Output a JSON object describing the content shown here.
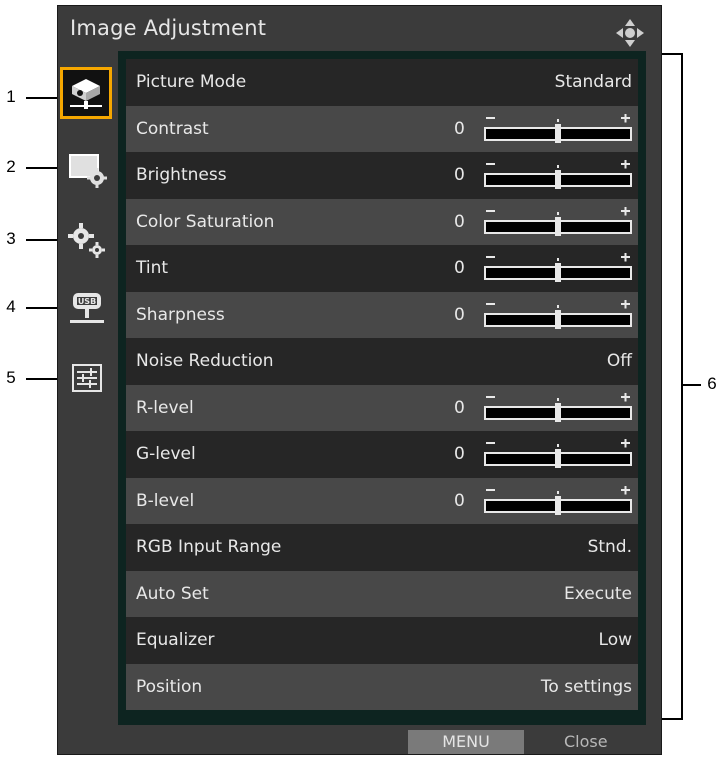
{
  "callouts": {
    "left": [
      "1",
      "2",
      "3",
      "4",
      "5"
    ],
    "right": "6"
  },
  "window": {
    "title": "Image Adjustment"
  },
  "sidebar": [
    {
      "icon": "image-adjustment-icon",
      "active": true
    },
    {
      "icon": "screen-settings-icon",
      "active": false
    },
    {
      "icon": "settings-gears-icon",
      "active": false
    },
    {
      "icon": "usb-network-icon",
      "active": false
    },
    {
      "icon": "information-icon",
      "active": false
    }
  ],
  "menu": {
    "items": [
      {
        "label": "Picture Mode",
        "value": "Standard"
      },
      {
        "label": "Contrast",
        "num": "0",
        "slider": true,
        "level": 0.5
      },
      {
        "label": "Brightness",
        "num": "0",
        "slider": true,
        "level": 0.5
      },
      {
        "label": "Color Saturation",
        "num": "0",
        "slider": true,
        "level": 0.5
      },
      {
        "label": "Tint",
        "num": "0",
        "slider": true,
        "level": 0.5
      },
      {
        "label": "Sharpness",
        "num": "0",
        "slider": true,
        "level": 0.5
      },
      {
        "label": "Noise Reduction",
        "value": "Off"
      },
      {
        "label": "R-level",
        "num": "0",
        "slider": true,
        "level": 0.5
      },
      {
        "label": "G-level",
        "num": "0",
        "slider": true,
        "level": 0.5
      },
      {
        "label": "B-level",
        "num": "0",
        "slider": true,
        "level": 0.5
      },
      {
        "label": "RGB Input Range",
        "value": "Stnd."
      },
      {
        "label": "Auto Set",
        "value": "Execute"
      },
      {
        "label": "Equalizer",
        "value": "Low"
      },
      {
        "label": "Position",
        "value": "To settings"
      }
    ]
  },
  "footer": {
    "menu_label": "MENU",
    "close_label": "Close"
  },
  "colors": {
    "active_border": "#f5a700",
    "panel_background": "#0d2420",
    "window_background": "#3b3b3b"
  }
}
